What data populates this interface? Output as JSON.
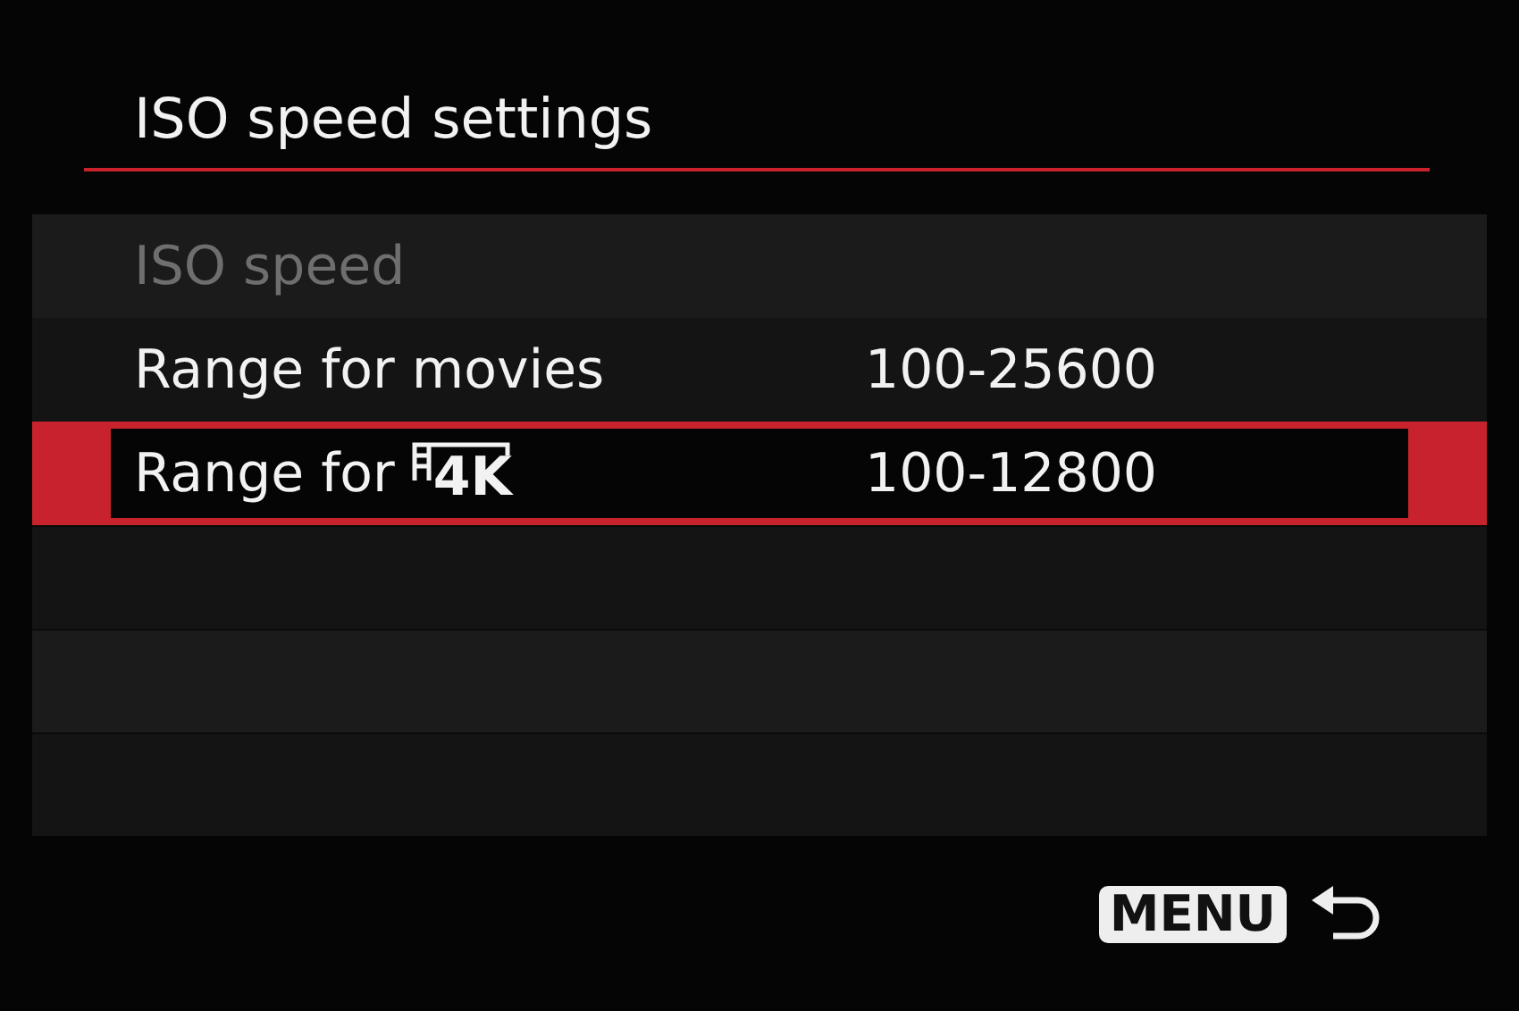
{
  "title": "ISO speed settings",
  "rows": [
    {
      "label": "ISO speed",
      "disabled": true,
      "selected": false
    },
    {
      "label": "Range for movies",
      "value": "100-25600",
      "disabled": false,
      "selected": false
    },
    {
      "label": "Range for ",
      "badge": "4K",
      "value": "100-12800",
      "disabled": false,
      "selected": true
    }
  ],
  "footer": {
    "key": "MENU"
  }
}
